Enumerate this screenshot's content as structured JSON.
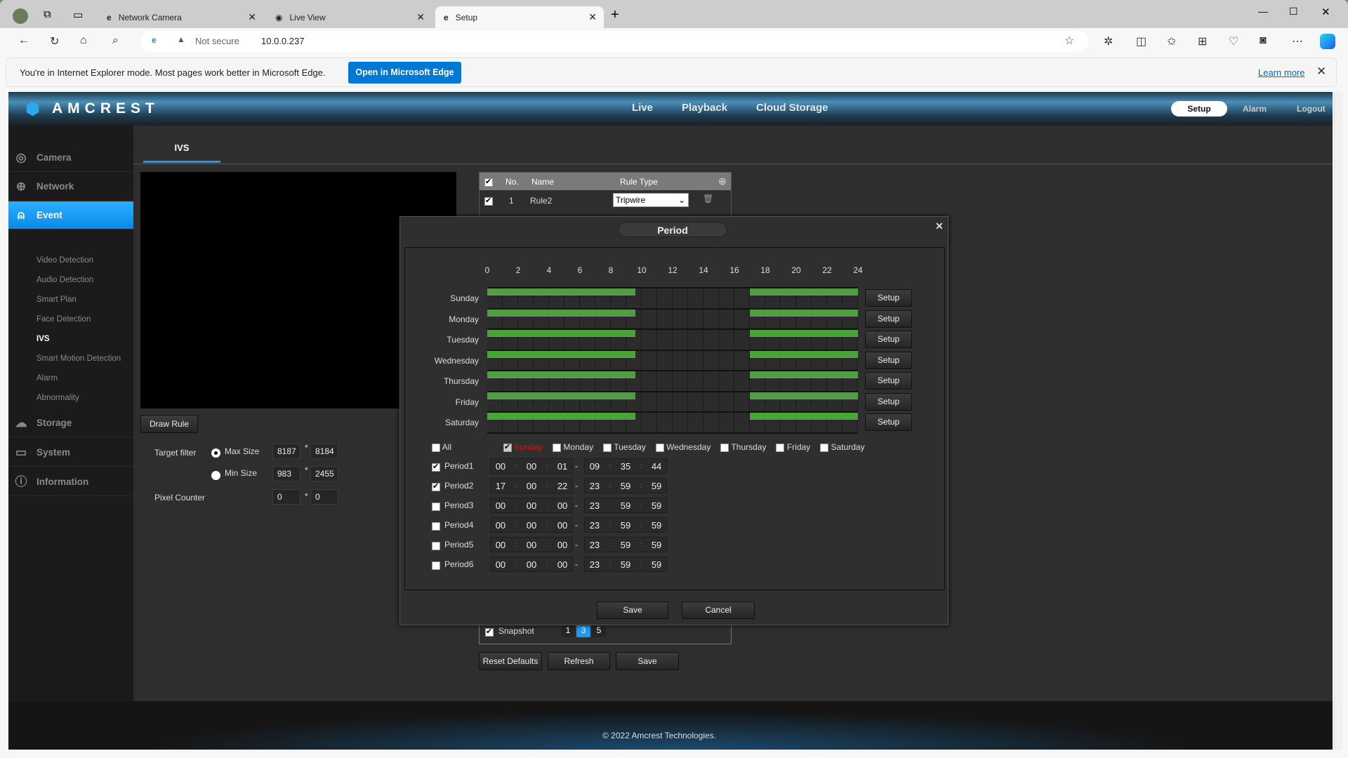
{
  "browser": {
    "tabs": [
      {
        "label": "Network Camera"
      },
      {
        "label": "Live View"
      },
      {
        "label": "Setup",
        "active": true
      }
    ],
    "security": "Not secure",
    "url": "10.0.0.237",
    "banner": {
      "text": "You're in Internet Explorer mode. Most pages work better in Microsoft Edge.",
      "button": "Open in Microsoft Edge",
      "link": "Learn more"
    },
    "accent": "#0078d4"
  },
  "app": {
    "logo": "AMCREST",
    "nav": [
      "Live",
      "Playback",
      "Cloud Storage"
    ],
    "right_nav": [
      "Setup",
      "Alarm",
      "Logout"
    ],
    "sidebar": [
      {
        "label": "Camera",
        "icon": "camera-icon"
      },
      {
        "label": "Network",
        "icon": "globe-icon"
      },
      {
        "label": "Event",
        "icon": "alarm-icon",
        "active": true,
        "children": [
          "Video Detection",
          "Audio Detection",
          "Smart Plan",
          "Face Detection",
          "IVS",
          "Smart Motion Detection",
          "Alarm",
          "Abnormality"
        ],
        "active_child": "IVS"
      },
      {
        "label": "Storage",
        "icon": "cloud-icon"
      },
      {
        "label": "System",
        "icon": "computer-icon"
      },
      {
        "label": "Information",
        "icon": "info-icon"
      }
    ],
    "tab": "IVS",
    "draw_rule": "Draw Rule",
    "target_filter": {
      "label": "Target filter",
      "max_label": "Max Size",
      "max": [
        "8187",
        "8184"
      ],
      "min_label": "Min Size",
      "min": [
        "983",
        "2455"
      ],
      "selected": "max",
      "sep": "*"
    },
    "pixel_counter": {
      "label": "Pixel Counter",
      "values": [
        "0",
        "0"
      ]
    },
    "rules_table": {
      "headers": [
        "No.",
        "Name",
        "Rule Type"
      ],
      "rows": [
        {
          "no": "1",
          "name": "Rule2",
          "type": "Tripwire",
          "checked": true
        }
      ]
    },
    "snapshot": {
      "label": "Snapshot",
      "checked": true,
      "options": [
        "1",
        "3",
        "5"
      ],
      "selected": "3"
    },
    "buttons": [
      "Reset Defaults",
      "Refresh",
      "Save"
    ],
    "footer": "© 2022 Amcrest Technologies.",
    "accent": "#1e9bf0"
  },
  "period_dialog": {
    "title": "Period",
    "hour_ticks": [
      "0",
      "2",
      "4",
      "6",
      "8",
      "10",
      "12",
      "14",
      "16",
      "18",
      "20",
      "22",
      "24"
    ],
    "days": [
      "Sunday",
      "Monday",
      "Tuesday",
      "Wednesday",
      "Thursday",
      "Friday",
      "Saturday"
    ],
    "setup_label": "Setup",
    "bar_color": "#4aa33a",
    "all_label": "All",
    "day_checks": [
      {
        "label": "Sunday",
        "checked": true,
        "current": true
      },
      {
        "label": "Monday"
      },
      {
        "label": "Tuesday"
      },
      {
        "label": "Wednesday"
      },
      {
        "label": "Thursday"
      },
      {
        "label": "Friday"
      },
      {
        "label": "Saturday"
      }
    ],
    "periods": [
      {
        "label": "Period1",
        "checked": true,
        "start": [
          "00",
          "00",
          "01"
        ],
        "end": [
          "09",
          "35",
          "44"
        ]
      },
      {
        "label": "Period2",
        "checked": true,
        "start": [
          "17",
          "00",
          "22"
        ],
        "end": [
          "23",
          "59",
          "59"
        ]
      },
      {
        "label": "Period3",
        "checked": false,
        "start": [
          "00",
          "00",
          "00"
        ],
        "end": [
          "23",
          "59",
          "59"
        ]
      },
      {
        "label": "Period4",
        "checked": false,
        "start": [
          "00",
          "00",
          "00"
        ],
        "end": [
          "23",
          "59",
          "59"
        ]
      },
      {
        "label": "Period5",
        "checked": false,
        "start": [
          "00",
          "00",
          "00"
        ],
        "end": [
          "23",
          "59",
          "59"
        ]
      },
      {
        "label": "Period6",
        "checked": false,
        "start": [
          "00",
          "00",
          "00"
        ],
        "end": [
          "23",
          "59",
          "59"
        ]
      }
    ],
    "save": "Save",
    "cancel": "Cancel"
  }
}
